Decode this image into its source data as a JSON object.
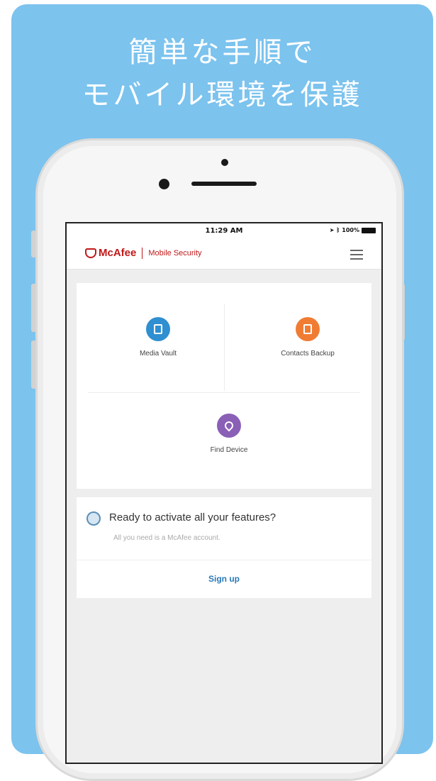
{
  "headline": {
    "line1": "簡単な手順で",
    "line2": "モバイル環境を保護"
  },
  "status_bar": {
    "time": "11:29 AM",
    "battery_text": "100%"
  },
  "app_header": {
    "brand_name": "McAfee",
    "product_name": "Mobile Security",
    "menu_icon": "hamburger-menu-icon"
  },
  "features": [
    {
      "label": "Media Vault",
      "icon": "lock-icon",
      "color": "#2f8fd1"
    },
    {
      "label": "Contacts Backup",
      "icon": "contacts-icon",
      "color": "#f07c34"
    },
    {
      "label": "Find Device",
      "icon": "location-pin-icon",
      "color": "#8a5fb6"
    }
  ],
  "activate_card": {
    "title": "Ready to activate all your features?",
    "subtitle": "All you need is a McAfee account.",
    "signup_label": "Sign up"
  },
  "colors": {
    "poster_background": "#7cc3ee",
    "brand_red": "#c01818",
    "link_blue": "#2a7ab8"
  }
}
